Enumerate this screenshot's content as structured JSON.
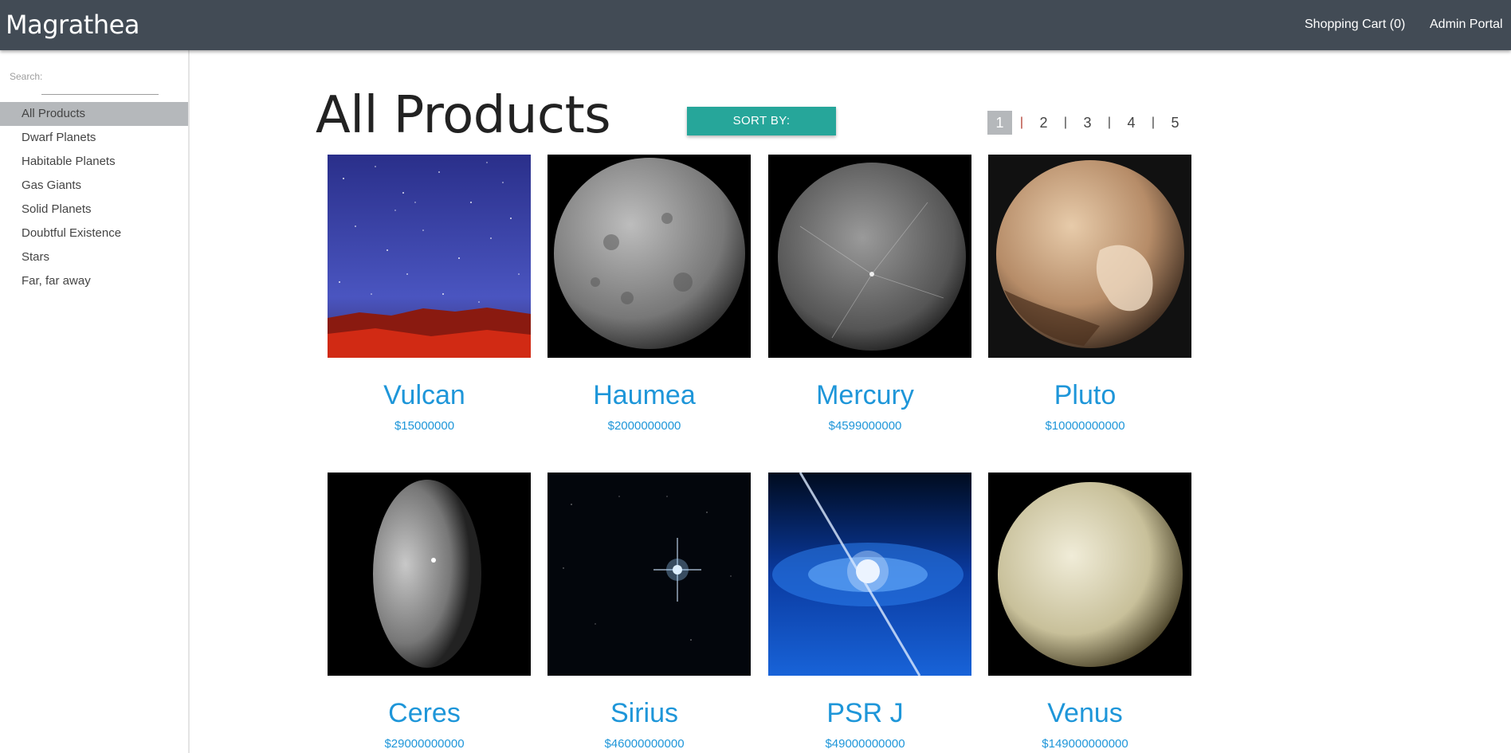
{
  "header": {
    "brand": "Magrathea",
    "cart_link": "Shopping Cart (0)",
    "admin_link": "Admin Portal"
  },
  "sidebar": {
    "search_label": "Search:",
    "search_value": "",
    "items": [
      {
        "label": "All Products",
        "active": true
      },
      {
        "label": "Dwarf Planets"
      },
      {
        "label": "Habitable Planets"
      },
      {
        "label": "Gas Giants"
      },
      {
        "label": "Solid Planets"
      },
      {
        "label": "Doubtful Existence"
      },
      {
        "label": "Stars"
      },
      {
        "label": "Far, far away"
      }
    ]
  },
  "main": {
    "title": "All Products",
    "sort_label": "SORT BY:",
    "pages": [
      "1",
      "2",
      "3",
      "4",
      "5"
    ],
    "current_page": "1",
    "products": [
      {
        "name": "Vulcan",
        "price": "$15000000",
        "image": "starry-sky-red-mountain"
      },
      {
        "name": "Haumea",
        "price": "$2000000000",
        "image": "grey-cratered-sphere"
      },
      {
        "name": "Mercury",
        "price": "$4599000000",
        "image": "mercury-planet"
      },
      {
        "name": "Pluto",
        "price": "$10000000000",
        "image": "pluto-planet"
      },
      {
        "name": "Ceres",
        "price": "$29000000000",
        "image": "ceres-crescent"
      },
      {
        "name": "Sirius",
        "price": "$46000000000",
        "image": "bright-star-starfield"
      },
      {
        "name": "PSR J",
        "price": "$49000000000",
        "image": "blue-pulsar-disc"
      },
      {
        "name": "Venus",
        "price": "$149000000000",
        "image": "venus-planet"
      }
    ]
  },
  "colors": {
    "topbar": "#424b55",
    "accent_teal": "#26a69a",
    "link_blue": "#1e96d9",
    "active_grey": "#b5b8bb"
  }
}
